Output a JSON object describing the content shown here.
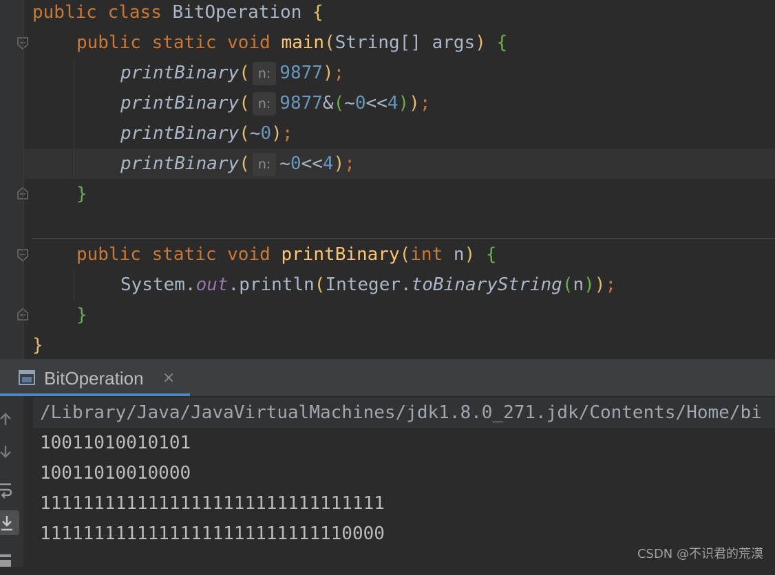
{
  "editor": {
    "lines": {
      "class_kw1": "public",
      "class_kw2": "class",
      "class_name": "BitOperation",
      "main_kw1": "public",
      "main_kw2": "static",
      "main_kw3": "void",
      "main_name": "main",
      "main_params": "String[] args",
      "call_name": "printBinary",
      "hint_label": "n:",
      "call1_arg": "9877",
      "call2_arg_a": "9877",
      "call2_arg_b": "&",
      "call2_arg_c": "~",
      "call2_arg_d": "0",
      "call2_arg_e": "<<",
      "call2_arg_f": "4",
      "call3_arg_a": "~",
      "call3_arg_b": "0",
      "call4_arg_a": "~",
      "call4_arg_b": "0",
      "call4_arg_c": "<<",
      "call4_arg_d": "4",
      "pb_kw1": "public",
      "pb_kw2": "static",
      "pb_kw3": "void",
      "pb_name": "printBinary",
      "pb_type": "int",
      "pb_param": "n",
      "sys": "System",
      "out_field": "out",
      "println": "println",
      "integer": "Integer",
      "to_binary": "toBinaryString",
      "arg_n": "n"
    }
  },
  "run_panel": {
    "tab_title": "BitOperation",
    "tab_close": "×",
    "command": "/Library/Java/JavaVirtualMachines/jdk1.8.0_271.jdk/Contents/Home/bi",
    "output": [
      "10011010010101",
      "10011010010000",
      "11111111111111111111111111111111",
      "11111111111111111111111111110000"
    ],
    "toolbar": [
      "arrow-up-icon",
      "arrow-down-icon",
      "soft-wrap-icon",
      "scroll-to-end-icon",
      "print-icon"
    ]
  },
  "watermark": "CSDN @不识君的荒漠",
  "colors": {
    "keyword": "#cc7832",
    "function": "#ffc66d",
    "number": "#6897bb",
    "field": "#9876aa",
    "tab_accent": "#4a88c7"
  }
}
